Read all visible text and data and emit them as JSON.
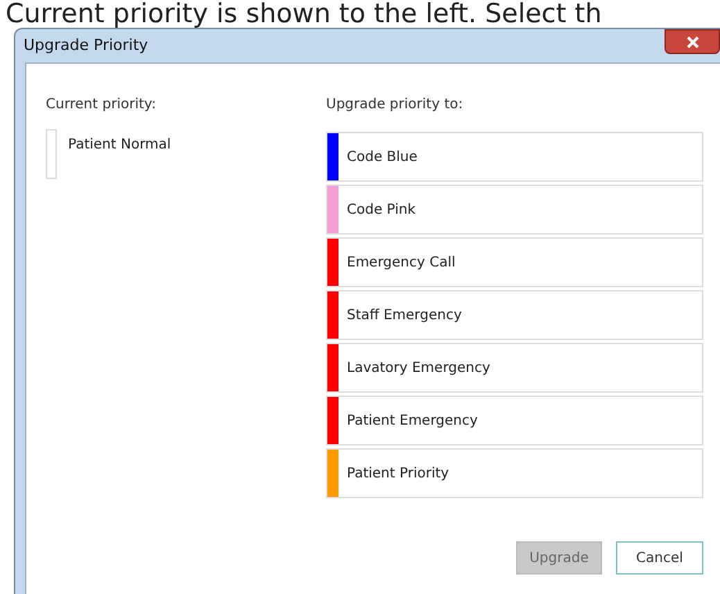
{
  "background_text": "Current priority is shown to the left. Select th",
  "window": {
    "title": "Upgrade Priority"
  },
  "current": {
    "label": "Current priority:",
    "name": "Patient Normal"
  },
  "upgrade": {
    "label": "Upgrade priority to:",
    "options": [
      {
        "name": "Code Blue",
        "color": "#0000ff"
      },
      {
        "name": "Code Pink",
        "color": "#f59ed6"
      },
      {
        "name": "Emergency Call",
        "color": "#ff0000"
      },
      {
        "name": "Staff Emergency",
        "color": "#ff0000"
      },
      {
        "name": "Lavatory Emergency",
        "color": "#ff0000"
      },
      {
        "name": "Patient Emergency",
        "color": "#ff0000"
      },
      {
        "name": "Patient Priority",
        "color": "#ff9900"
      }
    ]
  },
  "buttons": [
    {
      "label": "Upgrade",
      "disabled": true
    },
    {
      "label": "Cancel",
      "disabled": false
    }
  ]
}
